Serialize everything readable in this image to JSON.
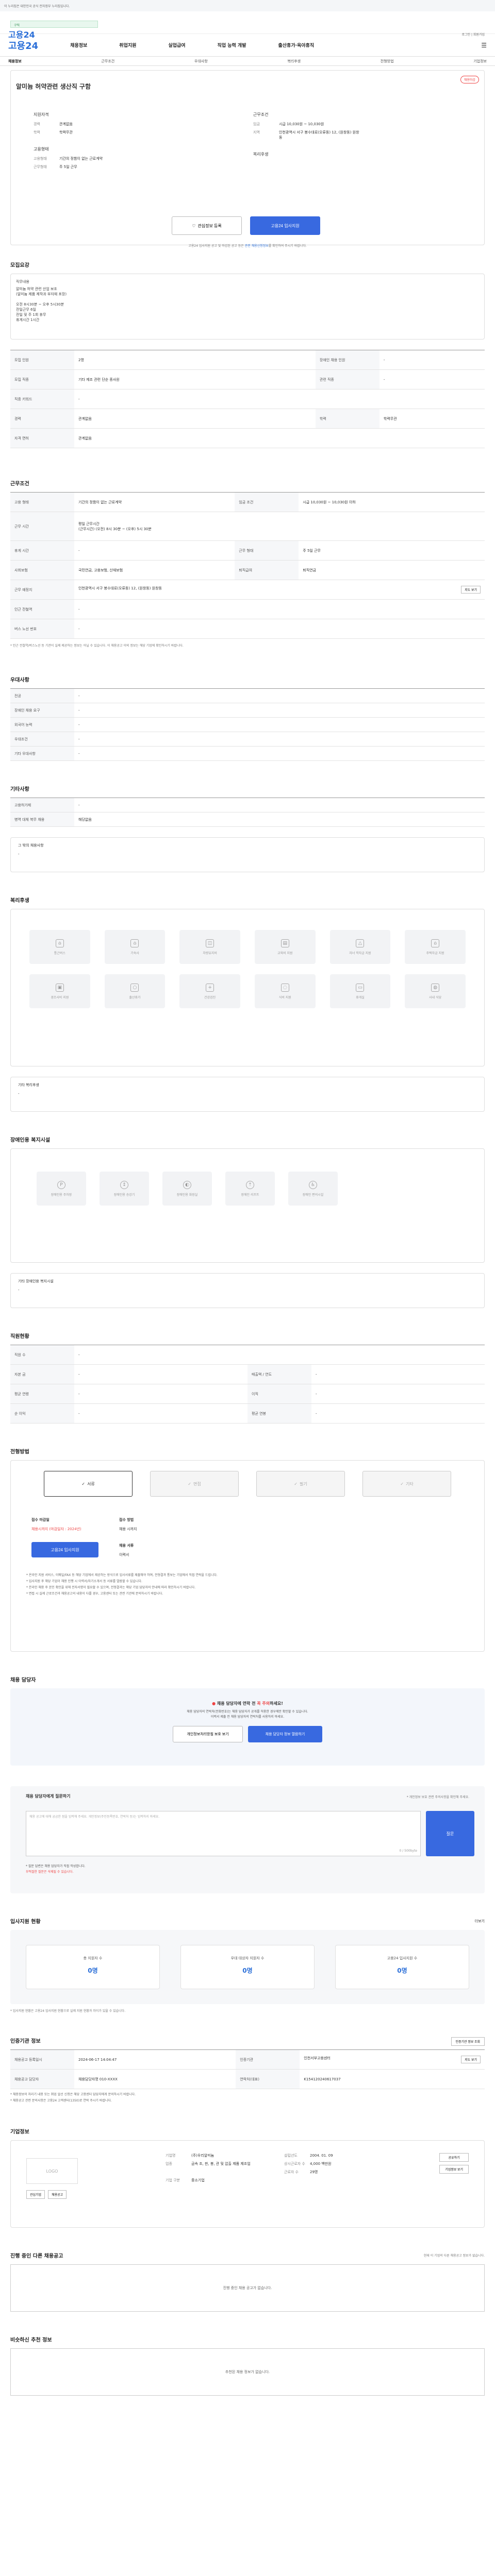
{
  "gov": {
    "text": "이 누리집은 대한민국 공식 전자정부 누리집입니다."
  },
  "top": {
    "logo": "고용24",
    "search": "구직",
    "util": "로그인 | 회원가입"
  },
  "gnb": {
    "logo": "고용24",
    "items": [
      "채용정보",
      "취업지원",
      "실업급여",
      "직업 능력 개발",
      "출산휴가·육아휴직"
    ]
  },
  "lnb": [
    "채용정보",
    "근무조건",
    "우대사항",
    "복리후생",
    "전형방법",
    "기업정보"
  ],
  "job": {
    "title": "알미늄 허약관련 생산직 구함",
    "badge": "채용마감",
    "l_label": "지원자격",
    "l_rows": [
      {
        "k": "경력",
        "v": "관계없음"
      },
      {
        "k": "학력",
        "v": "학력무관"
      }
    ],
    "l2_label": "고용형태",
    "l2_rows": [
      {
        "k": "고용형태",
        "v": "기간의 정함이 없는 근로계약"
      },
      {
        "k": "근무형태",
        "v": "주 5일 근무"
      }
    ],
    "r_label": "근무조건",
    "r_rows": [
      {
        "k": "임금",
        "v": "시급 10,030원 ~ 10,030원"
      },
      {
        "k": "지역",
        "v": "인천광역시 서구 봉수대로(오류동) 12, (원창동) 원창동"
      }
    ],
    "r2_label": "복리후생",
    "btn_save": "관심정보 등록",
    "btn_apply": "고용24 입사지원",
    "note_pre": "고용24 입사지원 공고 및 마감된 공고 등은 ",
    "note_link": "관련 채용신청정보",
    "note_post": "를 확인하여 주시기 바랍니다."
  },
  "sec1": {
    "title": "모집요강",
    "desc_label": "직무내용",
    "desc": "알미늄 허약 관련 산업 보조\n(알미늄 제품 제작과 부자재 포장)\n\n오전 8시30분 ~ 오후 5시30분\n전일근무 6일\n전일 및 주 1회 휴무\n휴게시간 1시간",
    "rows": [
      {
        "k1": "모집 인원",
        "v1": "2명",
        "k2": "장애인 채용 인원",
        "v2": "-"
      },
      {
        "k1": "모집 직종",
        "v1": "기타 제조 관련 단순 종사원",
        "k2": "관련 직종",
        "v2": "-"
      },
      {
        "k1": "직종 키워드",
        "v1": "-",
        "k2": "",
        "v2": ""
      },
      {
        "k1": "경력",
        "v1": "관계없음",
        "k2": "학력",
        "v2": "학력무관"
      },
      {
        "k1": "자격 면허",
        "v1": "관계없음",
        "k2": "",
        "v2": ""
      }
    ]
  },
  "sec2": {
    "title": "근무조건",
    "rows": [
      {
        "k1": "고용 형태",
        "v1": "기간의 정함이 없는 근로계약",
        "k2": "임금 조건",
        "v2": "시급 10,030원 ~ 10,030원 이하"
      },
      {
        "k1": "근무 시간",
        "v1": "(근무시간) (오전) 8시 30분 ~ (오후) 5시 30분",
        "v1b": "평일 근무시간",
        "k2": "",
        "v2": ""
      },
      {
        "k1": "휴게 시간",
        "v1": "-",
        "k2": "근무 형태",
        "v2": "주 5일 근무"
      },
      {
        "k1": "사회보험",
        "v1": "국민연금, 고용보험, 산재보험",
        "k2": "퇴직급여",
        "v2": "퇴직연금"
      },
      {
        "k1": "근무 예정지",
        "v1": "인천광역시 서구 봉수대로(오류동) 12, (원창동) 원창동",
        "k2": "",
        "v2": "지도 보기"
      },
      {
        "k1": "인근 전철역",
        "v1": "-",
        "k2": "",
        "v2": ""
      },
      {
        "k1": "버스 노선 번호",
        "v1": "-",
        "k2": "",
        "v2": ""
      }
    ],
    "note": "* 인근 전철역/버스노선 등 기관이 실제 제공하는 정보는 아닐 수 있습니다. 이 채용공고 이외 정보는 해당 기업에 확인하시기 바랍니다."
  },
  "sec3": {
    "title": "우대사항",
    "rows": [
      {
        "k": "전공",
        "v": "-"
      },
      {
        "k": "장애인 채용 요구",
        "v": "-"
      },
      {
        "k": "외국어 능력",
        "v": "-"
      },
      {
        "k": "우대조건",
        "v": "-"
      },
      {
        "k": "기타 우대사항",
        "v": "-"
      }
    ]
  },
  "sec4": {
    "title": "기타사항",
    "rows": [
      {
        "k": "고용허가제",
        "v": "-"
      },
      {
        "k": "병역 대체 복무 채용",
        "v": "해당없음"
      }
    ],
    "box_label": "그 밖의 채용사항",
    "box_val": "-"
  },
  "sec5": {
    "title": "복리후생",
    "items": [
      "통근버스",
      "기숙사",
      "차량유지비",
      "교육비 지원",
      "자녀 학자금 지원",
      "주택자금 지원",
      "경조사비 지원",
      "출산휴가",
      "건강검진",
      "식비 지원",
      "휴게실",
      "사내 식당"
    ],
    "other_label": "기타 복리후생",
    "other_val": "-"
  },
  "sec6": {
    "title": "장애인용 복지시설",
    "items": [
      "장애인용 주차장",
      "장애인용 승강기",
      "장애인용 화장실",
      "장애인 리프트",
      "장애인 편의시설"
    ],
    "other_label": "기타 장애인용 복지시설",
    "other_val": "-"
  },
  "sec7": {
    "title": "직원현황",
    "rows": [
      {
        "k1": "직원 수",
        "v1": "-",
        "k2": "",
        "v2": ""
      },
      {
        "k1": "자본 금",
        "v1": "-",
        "k2": "매출액 / 연도",
        "v2": "-"
      },
      {
        "k1": "평균 연령",
        "v1": "-",
        "k2": "이직",
        "v2": "-"
      },
      {
        "k1": "순 이익",
        "v1": "-",
        "k2": "평균 연봉",
        "v2": "-"
      }
    ]
  },
  "sec8": {
    "title": "전형방법",
    "tabs": [
      "서류",
      "면접",
      "필기",
      "기타"
    ],
    "rows": [
      {
        "k": "접수 마감일",
        "v": "채용시까지 (마감일자 : 2024년)",
        "b": "고용24 입사지원"
      },
      {
        "k": "접수 방법",
        "v": "채용 시까지"
      },
      {
        "k": "채용 서류",
        "v": "이력서"
      }
    ],
    "bullets": [
      "* 온라인 지원 서비스, 이메일/FAX 등 해당 기업에서 제공하는 방식으로 입사서류를 제출해야 하며, 전형결과 통보는 기업에서 직접 연락을 드립니다.",
      "* 입사지원 후 해당 기업이 채용 진행 시 이력서/자기소개서 등 서류를 열람할 수 있습니다.",
      "* 온라인 채용 후 본인 확인을 위해 전자서명이 필요할 수 있으며, 전형결과는 해당 기업 담당자의 안내에 따라 확인하시기 바랍니다.",
      "* 면접 시 실제 근로조건과 채용공고의 내용이 다를 경우, 고용센터 또는 관련 기관에 문의하시기 바랍니다."
    ]
  },
  "sec9": {
    "title": "채용 담당자",
    "warn_pre": "채용 담당자에 연락 전 ",
    "warn_em": "꼭 주의",
    "warn_post": "하세요!",
    "text": "채용 담당자의 연락처(전화번호)는 채용 담당자가 공개를 허용한 경우에만 확인할 수 있습니다.\n이력서 제출 전 채용 담당자의 연락처를 사용하지 마세요.",
    "btn1": "개인정보처리방침 보호 보기",
    "btn2": "채용 담당자 정보 열람하기"
  },
  "sec10": {
    "title": "채용 담당자에게 질문하기",
    "limit": "0 / 500byte",
    "placeholder": "채용 공고에 대해 궁금한 점을 입력해 주세요. 개인정보(주민등록번호, 연락처 등)는 입력하지 마세요.",
    "btn": "질문",
    "count_label": "* 개인정보 보호 관련 주의사항을 확인해 주세요.",
    "note1": "* 질문 답변은 채용 담당자가 직접 작성합니다.",
    "note2": "부적절한 질문은 삭제될 수 있습니다."
  },
  "sec11": {
    "title": "입사지원 현황",
    "more": "더보기",
    "stats": [
      {
        "label": "총 지원자 수",
        "val": "0명"
      },
      {
        "label": "우대 대상자 지원자 수",
        "val": "0명"
      },
      {
        "label": "고용24 입사지원 수",
        "val": "0명"
      }
    ],
    "note": "* 입사지원 현황은 고용24 입사지원 현황으로 실제 지원 현황과 차이가 있을 수 있습니다."
  },
  "sec12": {
    "title": "인증기관 정보",
    "btn": "인증기관 정보 조회",
    "rows": [
      {
        "k1": "채용공고 등록일시",
        "v1": "2024-06-17 14:04:47",
        "k2": "인증기관",
        "v2": "인천서부고용센터",
        "b": "지도 보기"
      },
      {
        "k1": "채용공고 담당자",
        "v1": "채용담당자명 010-XXXX",
        "k2": "연락처(대표)",
        "v2": "K154120240617037"
      }
    ],
    "bullets": [
      "* 채용정보의 처리기 내용 또는 취업 알선 신청은 해당 고용센터 담당자에게 문의하시기 바랍니다.",
      "* 채용공고 관련 문의사항은 고용24 고객센터(1350)로 연락 주시기 바랍니다."
    ]
  },
  "sec13": {
    "title": "기업정보",
    "logo_ph": "LOGO",
    "rows": [
      {
        "k": "기업명",
        "v": "(주)우리알미늄",
        "k2": "설립년도",
        "v2": "2004. 01. 09"
      },
      {
        "k": "업종",
        "v": "금속 조, 판, 봉, 관 및 압출 제품 제조업",
        "k2": "상시근로자 수",
        "v2": "4,000 백만원"
      },
      {
        "k": "",
        "v": "",
        "k2": "근로자 수",
        "v2": "29명"
      },
      {
        "k": "기업 구분",
        "v": "중소기업",
        "k2": "",
        "v2": ""
      }
    ],
    "btn_share": "공유하기",
    "btn_more": "기업정보 보기",
    "btn_a": "관심기업",
    "btn_b": "채용공고"
  },
  "sec14": {
    "title": "진행 중인 다른 채용공고",
    "more": "현재 이 기업의 다른 채용공고 정보가 없습니다.",
    "empty": "진행 중인 채용 공고가 없습니다."
  },
  "sec15": {
    "title": "비슷하신 추천 정보",
    "empty": "추천된 채용 정보가 없습니다."
  }
}
